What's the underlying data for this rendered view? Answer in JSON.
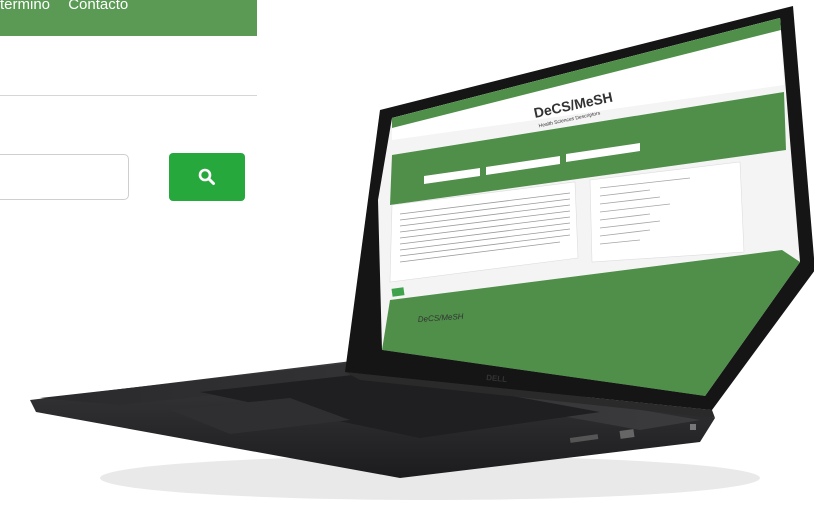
{
  "header": {
    "nav_items": [
      {
        "label": "termino"
      },
      {
        "label": "Contacto"
      }
    ]
  },
  "search": {
    "placeholder": "",
    "button_icon": "search-icon"
  },
  "laptop_screen": {
    "logo_title": "DeCS/MeSH",
    "logo_subtitle": "Health Sciences Descriptors",
    "footer_logo": "DeCS/MeSH",
    "brand": "DELL"
  },
  "colors": {
    "header_green": "#5a9a55",
    "button_green": "#27a83d",
    "screen_green": "#4f8f4a"
  }
}
